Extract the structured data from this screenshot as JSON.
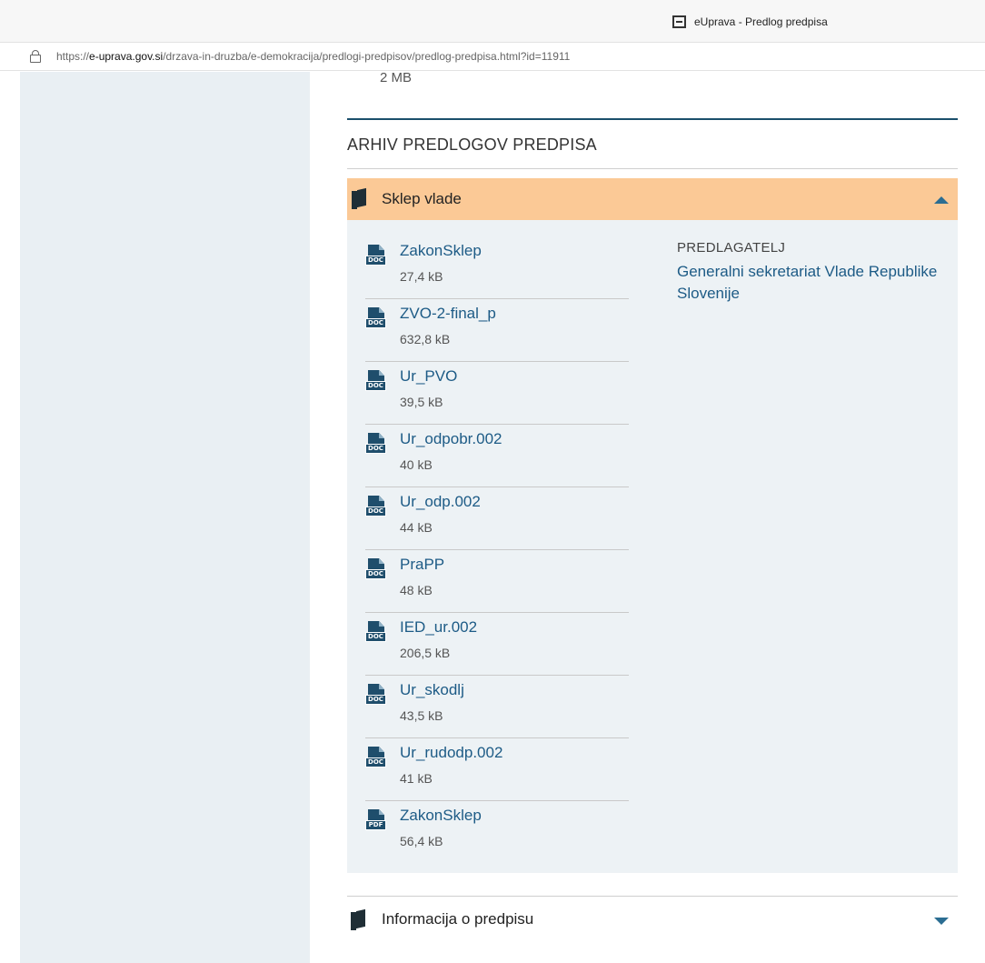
{
  "browser": {
    "tab_title": "eUprava - Predlog predpisa",
    "url_scheme": "https://",
    "url_host": "e-uprava.gov.si",
    "url_path": "/drzava-in-druzba/e-demokracija/predlogi-predpisov/predlog-predpisa.html?id=11911"
  },
  "content": {
    "previous_size": "2 MB",
    "section_title": "ARHIV PREDLOGOV PREDPISA",
    "accordion_open": {
      "title": "Sklep vlade",
      "icon": "book-icon",
      "files": [
        {
          "name": "ZakonSklep",
          "size": "27,4 kB",
          "type": "DOC"
        },
        {
          "name": "ZVO-2-final_p",
          "size": "632,8 kB",
          "type": "DOC"
        },
        {
          "name": "Ur_PVO",
          "size": "39,5 kB",
          "type": "DOC"
        },
        {
          "name": "Ur_odpobr.002",
          "size": "40 kB",
          "type": "DOC"
        },
        {
          "name": "Ur_odp.002",
          "size": "44 kB",
          "type": "DOC"
        },
        {
          "name": "PraPP",
          "size": "48 kB",
          "type": "DOC"
        },
        {
          "name": "IED_ur.002",
          "size": "206,5 kB",
          "type": "DOC"
        },
        {
          "name": "Ur_skodlj",
          "size": "43,5 kB",
          "type": "DOC"
        },
        {
          "name": "Ur_rudodp.002",
          "size": "41 kB",
          "type": "DOC"
        },
        {
          "name": "ZakonSklep",
          "size": "56,4 kB",
          "type": "PDF"
        }
      ],
      "proposer_label": "PREDLAGATELJ",
      "proposer_name": "Generalni sekretariat Vlade Republike Slovenije"
    },
    "accordion_closed": {
      "title": "Informacija o predpisu",
      "icon": "book-icon"
    }
  },
  "colors": {
    "accent_header": "#fbc996",
    "link": "#1d5b86",
    "rule": "#1b4f6b",
    "panel": "#edf2f5",
    "sidebar": "#e9eff3"
  }
}
